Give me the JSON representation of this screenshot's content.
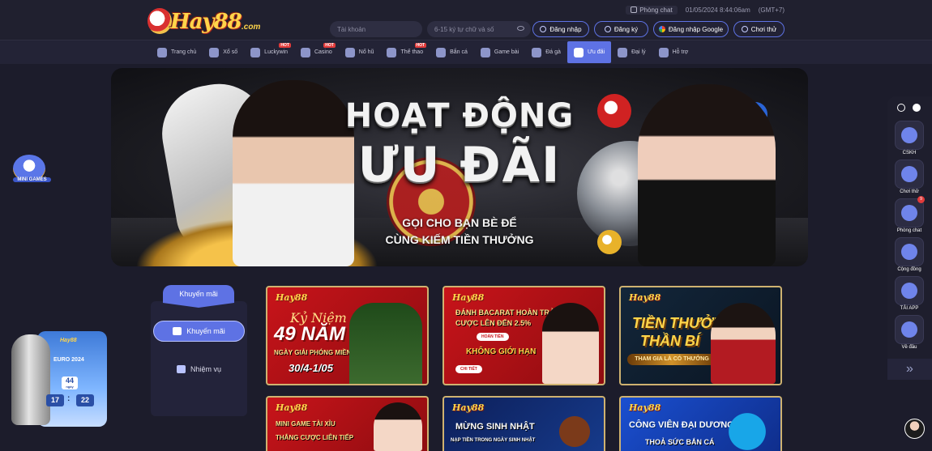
{
  "header": {
    "logo_text": "Hay88",
    "logo_suffix": ".com",
    "chat_label": "Phòng chat",
    "datetime": "01/05/2024 8:44:06am",
    "timezone": "(GMT+7)",
    "account_placeholder": "Tài khoản",
    "password_placeholder": "6-15 ký tự chữ và số",
    "login_label": "Đăng nhập",
    "register_label": "Đăng ký",
    "google_label": "Đăng nhập Google",
    "try_label": "Chơi thử"
  },
  "nav": {
    "items": [
      {
        "label": "Trang chủ",
        "hot": ""
      },
      {
        "label": "Xổ số",
        "hot": ""
      },
      {
        "label": "Luckywin",
        "hot": "HOT"
      },
      {
        "label": "Casino",
        "hot": "HOT"
      },
      {
        "label": "Nổ hũ",
        "hot": ""
      },
      {
        "label": "Thể thao",
        "hot": "HOT"
      },
      {
        "label": "Bắn cá",
        "hot": ""
      },
      {
        "label": "Game bài",
        "hot": ""
      },
      {
        "label": "Đá gà",
        "hot": ""
      },
      {
        "label": "Ưu đãi",
        "hot": ""
      },
      {
        "label": "Đại lý",
        "hot": ""
      },
      {
        "label": "Hỗ trợ",
        "hot": ""
      }
    ],
    "active": "Ưu đãi"
  },
  "banner": {
    "title_line1": "HOẠT ĐỘNG",
    "title_line2": "ƯU ĐÃI",
    "subtitle_line1": "GỌI CHO BẠN BÈ ĐỂ",
    "subtitle_line2": "CÙNG KIẾM TIỀN THƯỞNG"
  },
  "left_float": {
    "label": "MINI GAMES",
    "euro_brand": "Hay88",
    "euro_event": "EURO 2024",
    "days_value": "44",
    "days_unit": "ngày",
    "hours_value": "17",
    "minutes_value": "22",
    "colon": ":"
  },
  "right_sidebar": {
    "items": [
      {
        "label": "CSKH",
        "icon": "headset-icon"
      },
      {
        "label": "Chơi thử",
        "icon": "gamepad-icon"
      },
      {
        "label": "Phòng chat",
        "icon": "chat-icon",
        "badge": "9"
      },
      {
        "label": "Cộng đồng",
        "icon": "telegram-icon"
      },
      {
        "label": "TẢI APP",
        "icon": "mobile-app-icon"
      },
      {
        "label": "Về đầu",
        "icon": "arrow-up-icon"
      }
    ],
    "collapse_glyph": "»"
  },
  "promo_menu": {
    "tab_label": "Khuyến mãi",
    "items": [
      {
        "label": "Khuyến mãi",
        "active": true
      },
      {
        "label": "Nhiệm vụ",
        "active": false
      }
    ]
  },
  "promo_cards": [
    {
      "brand": "Hay88",
      "script": "Kỷ Niệm",
      "big": "49 NĂM",
      "line_a": "NGÀY GIẢI PHÓNG MIỀN NAM",
      "line_b": "30/4-1/05"
    },
    {
      "brand": "Hay88",
      "line_a": "ĐÁNH BACARAT HOÀN TRẢ",
      "line_b": "CƯỢC LÊN ĐẾN 2.5%",
      "tag": "HOÀN TIỀN",
      "line_c": "KHÔNG GIỚI HẠN",
      "button": "CHI TIẾT"
    },
    {
      "brand": "Hay88",
      "title_a": "TIỀN THƯỞNG",
      "title_b": "THẦN BÍ",
      "ribbon": "THAM GIA LÀ CÓ THƯỞNG"
    },
    {
      "brand": "Hay88",
      "line_a": "MINI GAME TÀI XỈU",
      "line_b": "THẮNG CƯỢC LIÊN TIẾP"
    },
    {
      "brand": "Hay88",
      "big": "MỪNG SINH NHẬT",
      "line_a": "NẠP TIỀN TRONG NGÀY SINH NHẬT"
    },
    {
      "brand": "Hay88",
      "big": "CÔNG VIÊN ĐẠI DƯƠNG",
      "line_a": "THOẢ SỨC BẮN CÁ"
    }
  ]
}
